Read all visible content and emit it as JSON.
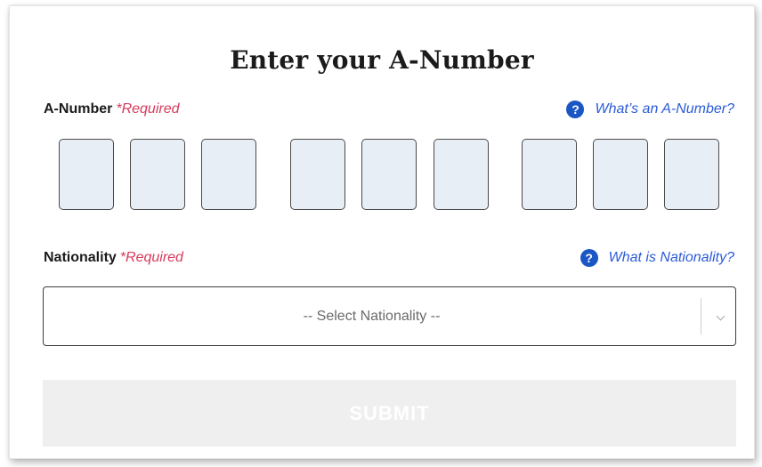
{
  "form": {
    "title": "Enter your A-Number",
    "a_number": {
      "label": "A-Number",
      "required": "*Required",
      "help_icon": "question-circle-icon",
      "help_text": "What’s an A-Number?",
      "digits": [
        "",
        "",
        "",
        "",
        "",
        "",
        "",
        "",
        ""
      ]
    },
    "nationality": {
      "label": "Nationality",
      "required": "*Required",
      "help_icon": "question-circle-icon",
      "help_text": "What is Nationality?",
      "selected": "-- Select Nationality --"
    },
    "submit_label": "SUBMIT"
  },
  "colors": {
    "required": "#d83a5c",
    "link": "#2a5bd7",
    "help_icon": "#1a56c4",
    "digit_fill": "#e8eef6",
    "submit_disabled": "#efefef"
  }
}
